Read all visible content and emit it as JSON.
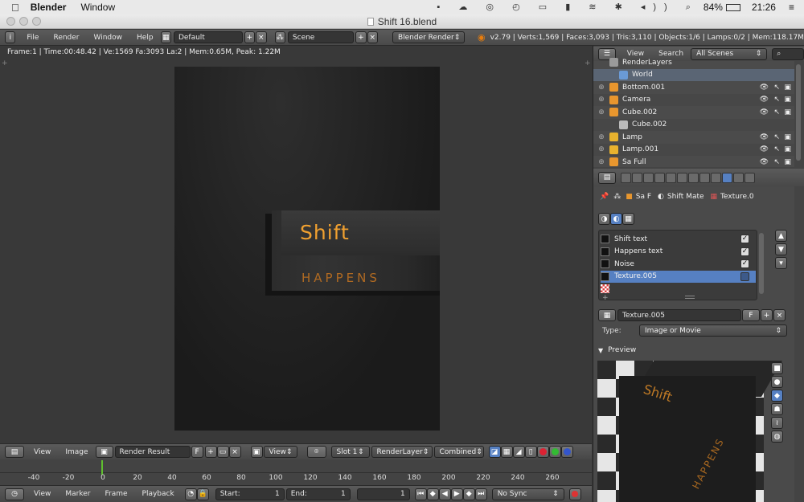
{
  "macos_menubar": {
    "app": "Blender",
    "menu": "Window",
    "battery": "84%",
    "clock": "21:26"
  },
  "window": {
    "title": "Shift 16.blend"
  },
  "info_header": {
    "menus": [
      "File",
      "Render",
      "Window",
      "Help"
    ],
    "layout": "Default",
    "scene": "Scene",
    "engine": "Blender Render",
    "stats": "v2.79 | Verts:1,569 | Faces:3,093 | Tris:3,110 | Objects:1/6 | Lamps:0/2 | Mem:118.17M"
  },
  "viewport": {
    "overlay_stats": "Frame:1 | Time:00:48.42 | Ve:1569 Fa:3093 La:2 | Mem:0.65M, Peak: 1.22M",
    "render_text_main": "Shift",
    "render_text_sub": "HAPPENS"
  },
  "image_editor_header": {
    "menus": [
      "View",
      "Image"
    ],
    "image": "Render Result",
    "fake_user": "F",
    "view": "View",
    "slot": "Slot 1",
    "layer": "RenderLayer",
    "pass": "Combined"
  },
  "timeline": {
    "ticks": [
      "-40",
      "-20",
      "0",
      "20",
      "40",
      "60",
      "80",
      "100",
      "120",
      "140",
      "160",
      "180",
      "200",
      "220",
      "240",
      "260"
    ],
    "current_frame_marker": 0
  },
  "timeline_header": {
    "menus": [
      "View",
      "Marker",
      "Frame",
      "Playback"
    ],
    "start_label": "Start:",
    "start_value": "1",
    "end_label": "End:",
    "end_value": "1",
    "current": "1",
    "sync": "No Sync"
  },
  "outliner": {
    "menus": [
      "View",
      "Search"
    ],
    "filter": "All Scenes",
    "rows": [
      {
        "label": "RenderLayers",
        "color": "#9a9a9a"
      },
      {
        "label": "World",
        "color": "#6a9ad6"
      },
      {
        "label": "Bottom.001",
        "color": "#e8962e"
      },
      {
        "label": "Camera",
        "color": "#e8962e"
      },
      {
        "label": "Cube.002",
        "color": "#e8962e"
      },
      {
        "label": "Cube.002",
        "color": "#bbbbbb"
      },
      {
        "label": "Lamp",
        "color": "#e8b22e"
      },
      {
        "label": "Lamp.001",
        "color": "#e8b22e"
      },
      {
        "label": "Sa Full",
        "color": "#e8962e"
      }
    ]
  },
  "properties": {
    "breadcrumb": [
      "Sa F",
      "Shift Mate",
      "Texture.0"
    ],
    "textures": [
      {
        "label": "Shift text",
        "checked": "✓"
      },
      {
        "label": "Happens text",
        "checked": "✓"
      },
      {
        "label": "Noise",
        "checked": "✓"
      },
      {
        "label": "Texture.005",
        "checked": ""
      }
    ],
    "texture_name": "Texture.005",
    "fake_user": "F",
    "type_label": "Type:",
    "type_value": "Image or Movie",
    "preview_label": "Preview",
    "preview_cube_text_1": "Shift",
    "preview_cube_text_2": "HAPPENS"
  }
}
